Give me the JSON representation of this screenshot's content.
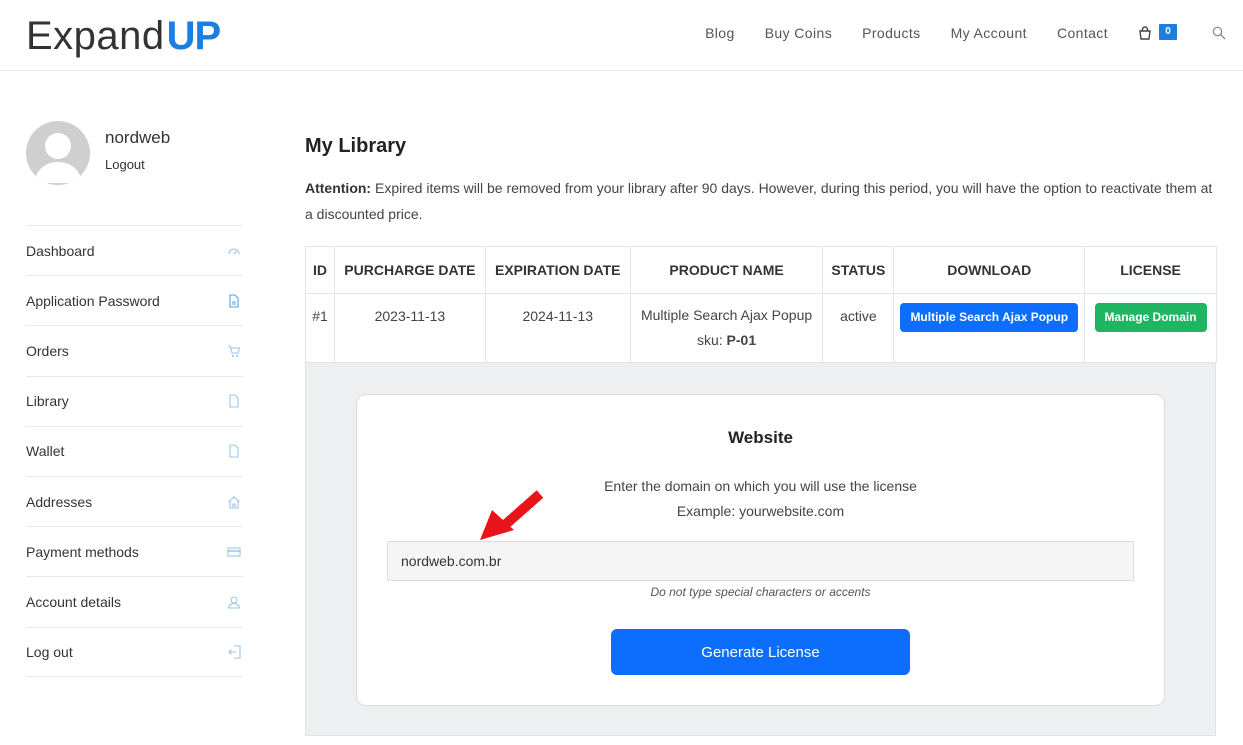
{
  "header": {
    "logo_left": "Expand",
    "logo_right": "UP",
    "nav": [
      "Blog",
      "Buy Coins",
      "Products",
      "My Account",
      "Contact"
    ],
    "cart_count": "0"
  },
  "profile": {
    "username": "nordweb",
    "logout": "Logout"
  },
  "sidebar": {
    "items": [
      {
        "label": "Dashboard",
        "icon": "dashboard-gauge-icon"
      },
      {
        "label": "Application Password",
        "icon": "file-icon"
      },
      {
        "label": "Orders",
        "icon": "cart-icon"
      },
      {
        "label": "Library",
        "icon": "file-icon"
      },
      {
        "label": "Wallet",
        "icon": "file-icon"
      },
      {
        "label": "Addresses",
        "icon": "home-icon"
      },
      {
        "label": "Payment methods",
        "icon": "credit-card-icon"
      },
      {
        "label": "Account details",
        "icon": "user-icon"
      },
      {
        "label": "Log out",
        "icon": "logout-icon"
      }
    ]
  },
  "main": {
    "title": "My Library",
    "attention_label": "Attention:",
    "attention_text": " Expired items will be removed from your library after 90 days. However, during this period, you will have the option to reactivate them at a discounted price."
  },
  "table": {
    "headers": [
      "ID",
      "PURCHARGE DATE",
      "EXPIRATION DATE",
      "PRODUCT NAME",
      "STATUS",
      "DOWNLOAD",
      "LICENSE"
    ],
    "rows": [
      {
        "id": "#1",
        "purchase_date": "2023-11-13",
        "expiration_date": "2024-11-13",
        "product_name": "Multiple Search Ajax Popup",
        "sku_label": "sku: ",
        "sku": "P-01",
        "status": "active",
        "download_label": "Multiple Search Ajax Popup",
        "license_label": "Manage Domain"
      }
    ]
  },
  "license_form": {
    "title": "Website",
    "description": "Enter the domain on which you will use the license",
    "example": "Example: yourwebsite.com",
    "domain_value": "nordweb.com.br",
    "hint": "Do not type special characters or accents",
    "button": "Generate License"
  },
  "colors": {
    "brand_blue": "#1a7fe0",
    "button_blue": "#0d6efd",
    "button_green": "#1fb663",
    "annotation_arrow": "#e8141a"
  }
}
